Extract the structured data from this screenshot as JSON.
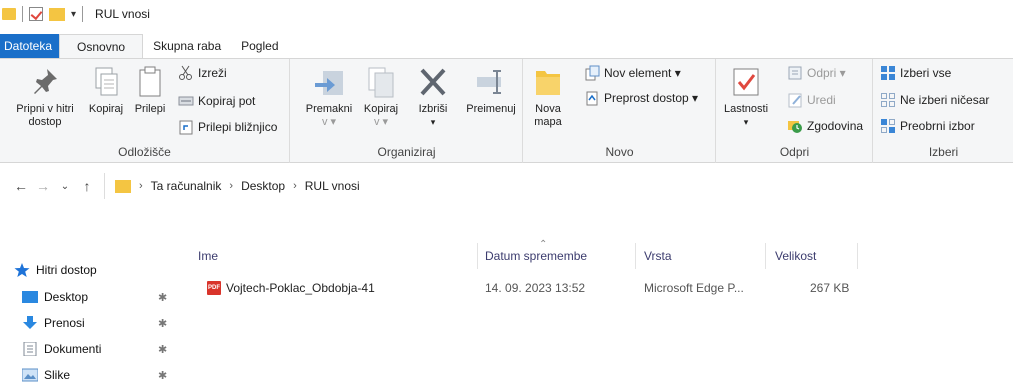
{
  "window": {
    "title": "RUL vnosi"
  },
  "tabs": [
    {
      "label": "Datoteka"
    },
    {
      "label": "Osnovno"
    },
    {
      "label": "Skupna raba"
    },
    {
      "label": "Pogled"
    }
  ],
  "ribbon": {
    "clipboard": {
      "label": "Odložišče",
      "pin_line1": "Pripni v hitri",
      "pin_line2": "dostop",
      "copy": "Kopiraj",
      "paste": "Prilepi",
      "cut": "Izreži",
      "copy_path": "Kopiraj pot",
      "paste_shortcut": "Prilepi bližnjico"
    },
    "organize": {
      "label": "Organiziraj",
      "move": "Premakni",
      "copy_to": "Kopiraj",
      "delete": "Izbriši",
      "rename": "Preimenuj"
    },
    "new": {
      "label": "Novo",
      "new_folder_line1": "Nova",
      "new_folder_line2": "mapa",
      "new_item": "Nov element ▾",
      "easy_access": "Preprost dostop ▾"
    },
    "open": {
      "label": "Odpri",
      "properties": "Lastnosti",
      "open": "Odpri ▾",
      "edit": "Uredi",
      "history": "Zgodovina"
    },
    "select": {
      "label": "Izberi",
      "select_all": "Izberi vse",
      "select_none": "Ne izberi ničesar",
      "invert": "Preobrni izbor"
    }
  },
  "address": {
    "crumbs": [
      "Ta računalnik",
      "Desktop",
      "RUL vnosi"
    ]
  },
  "navpane": {
    "quick_access": "Hitri dostop",
    "items": [
      {
        "label": "Desktop",
        "icon": "desktop-icon"
      },
      {
        "label": "Prenosi",
        "icon": "download-icon"
      },
      {
        "label": "Dokumenti",
        "icon": "documents-icon"
      },
      {
        "label": "Slike",
        "icon": "pictures-icon"
      }
    ]
  },
  "filelist": {
    "columns": {
      "name": "Ime",
      "date": "Datum spremembe",
      "type": "Vrsta",
      "size": "Velikost"
    },
    "rows": [
      {
        "name": "Vojtech-Poklac_Obdobja-41",
        "date": "14. 09. 2023 13:52",
        "type": "Microsoft Edge P...",
        "size": "267 KB",
        "icon_text": "PDF"
      }
    ]
  },
  "colors": {
    "file_tab": "#1a6fc9",
    "folder": "#f4c542",
    "pdf": "#d9342b"
  }
}
